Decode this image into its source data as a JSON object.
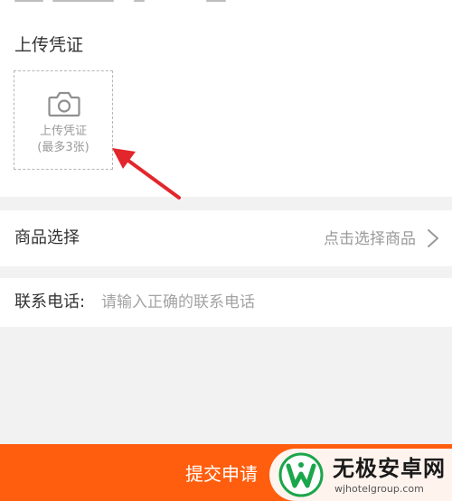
{
  "upload": {
    "title": "上传凭证",
    "box_line1": "上传凭证",
    "box_line2": "(最多3张)",
    "icon": "camera-icon"
  },
  "product": {
    "label": "商品选择",
    "value": "点击选择商品",
    "icon": "chevron-right-icon"
  },
  "phone": {
    "label": "联系电话:",
    "placeholder": "请输入正确的联系电话"
  },
  "submit": {
    "label": "提交申请"
  },
  "watermark": {
    "brand": "无极安卓网",
    "domain": "wjhotelgroup.com"
  },
  "colors": {
    "accent": "#ff5e0e",
    "arrow": "#e3262b",
    "logo_green": "#1aa64a"
  }
}
